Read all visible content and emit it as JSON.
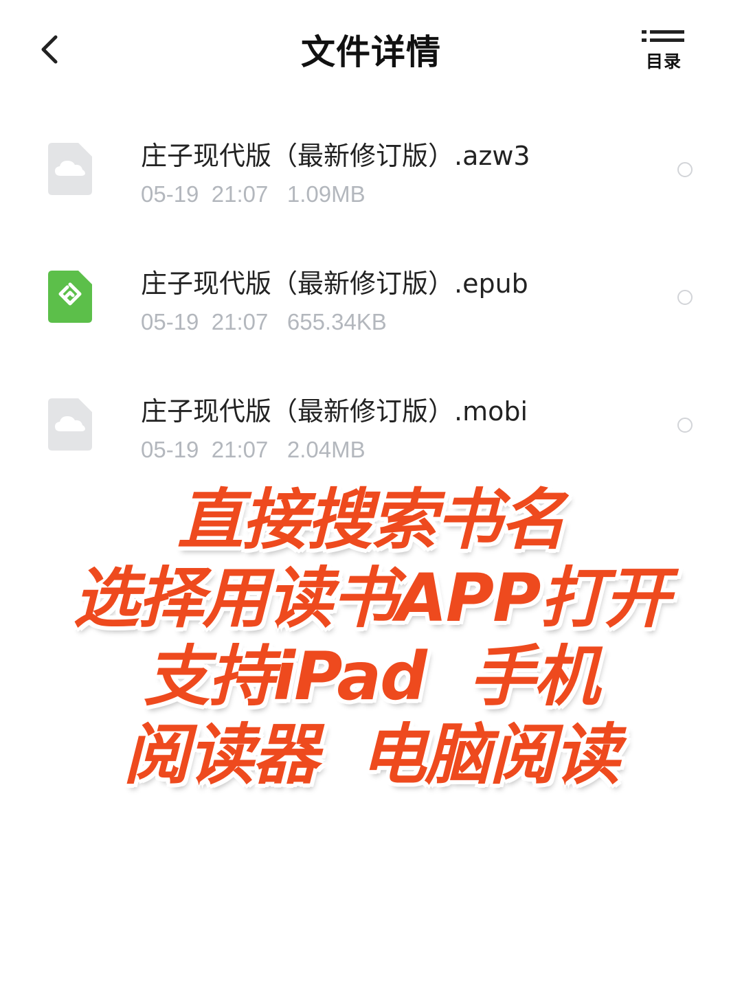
{
  "header": {
    "title": "文件详情",
    "back_icon": "chevron-left-icon",
    "toc_icon": "list-icon",
    "toc_label": "目录"
  },
  "files": [
    {
      "name": "庄子现代版（最新修订版）.azw3",
      "date": "05-19",
      "time": "21:07",
      "size": "1.09MB",
      "icon": "cloud-file-icon",
      "icon_color": "#e3e4e6",
      "selected": false
    },
    {
      "name": "庄子现代版（最新修订版）.epub",
      "date": "05-19",
      "time": "21:07",
      "size": "655.34KB",
      "icon": "epub-file-icon",
      "icon_color": "#5cbf4a",
      "selected": false
    },
    {
      "name": "庄子现代版（最新修订版）.mobi",
      "date": "05-19",
      "time": "21:07",
      "size": "2.04MB",
      "icon": "cloud-file-icon",
      "icon_color": "#e3e4e6",
      "selected": false
    }
  ],
  "overlay": {
    "lines": [
      "直接搜索书名",
      "选择用读书APP打开",
      "支持iPad  手机",
      "阅读器  电脑阅读"
    ],
    "text_color": "#ee4a1e",
    "outline_color": "#ffffff"
  }
}
